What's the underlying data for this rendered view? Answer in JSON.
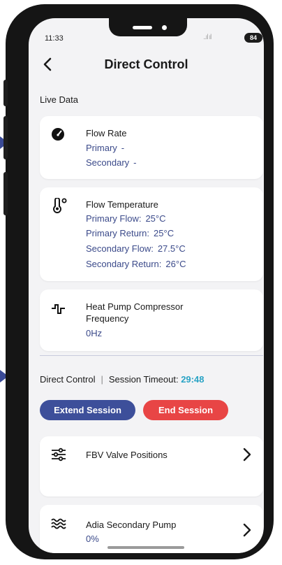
{
  "status_bar": {
    "time": "11:33",
    "signal": "..ıl ıl",
    "battery": "84"
  },
  "header": {
    "title": "Direct Control"
  },
  "live_data": {
    "label": "Live Data",
    "flow_rate": {
      "title": "Flow Rate",
      "rows": [
        {
          "label": "Primary",
          "value": "-"
        },
        {
          "label": "Secondary",
          "value": "-"
        }
      ]
    },
    "flow_temperature": {
      "title": "Flow Temperature",
      "rows": [
        {
          "label": "Primary Flow:",
          "value": "25°C"
        },
        {
          "label": "Primary Return:",
          "value": "25°C"
        },
        {
          "label": "Secondary Flow:",
          "value": "27.5°C"
        },
        {
          "label": "Secondary Return:",
          "value": "26°C"
        }
      ]
    },
    "compressor": {
      "title": "Heat Pump Compressor Frequency",
      "value": "0Hz"
    }
  },
  "direct_control": {
    "label": "Direct Control",
    "separator": "|",
    "timeout_label": "Session Timeout:",
    "timeout_value": "29:48",
    "extend_label": "Extend Session",
    "end_label": "End Session",
    "items": [
      {
        "title": "FBV Valve Positions",
        "value": ""
      },
      {
        "title": "Adia Secondary Pump",
        "value": "0%"
      }
    ]
  },
  "colors": {
    "accent_blue": "#3d4f9a",
    "danger_red": "#e84545",
    "timer_cyan": "#29a3c5",
    "value_blue": "#3b4a8a"
  }
}
